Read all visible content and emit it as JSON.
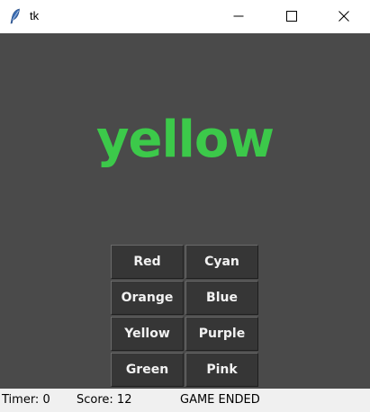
{
  "window": {
    "title": "tk"
  },
  "game": {
    "word": "yellow",
    "word_color": "#3cc94a"
  },
  "buttons": [
    "Red",
    "Cyan",
    "Orange",
    "Blue",
    "Yellow",
    "Purple",
    "Green",
    "Pink"
  ],
  "status": {
    "timer": "Timer: 0",
    "score": "Score: 12",
    "state": "GAME ENDED"
  },
  "colors": {
    "background": "#4a4a4a",
    "button_bg": "#363636",
    "button_text": "#f2f2f2",
    "status_bg": "#f0f0f0"
  },
  "icons": {
    "app": "feather-icon",
    "minimize": "minimize-icon",
    "maximize": "maximize-icon",
    "close": "close-icon"
  }
}
